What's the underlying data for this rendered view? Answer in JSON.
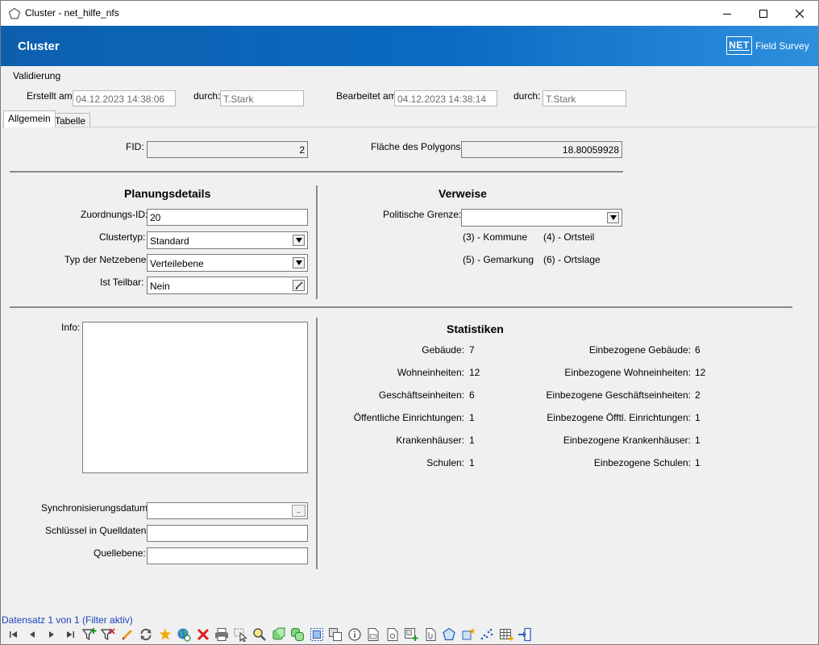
{
  "window": {
    "title": "Cluster - net_hilfe_nfs"
  },
  "banner": {
    "title": "Cluster",
    "logo_text": "NET",
    "product": "Field Survey"
  },
  "validation": {
    "heading": "Validierung",
    "created_label": "Erstellt am:",
    "created_value": "04.12.2023 14:38:06",
    "created_by_label": "durch:",
    "created_by_value": "T.Stark",
    "edited_label": "Bearbeitet am:",
    "edited_value": "04.12.2023 14:38:14",
    "edited_by_label": "durch:",
    "edited_by_value": "T.Stark"
  },
  "tabs": [
    {
      "label": "Allgemein",
      "active": true
    },
    {
      "label": "Tabelle",
      "active": false
    }
  ],
  "general": {
    "fid_label": "FID:",
    "fid_value": "2",
    "area_label": "Fläche des Polygons:",
    "area_value": "18.80059928"
  },
  "planning": {
    "title": "Planungsdetails",
    "assignment_id_label": "Zuordnungs-ID:",
    "assignment_id_value": "20",
    "cluster_type_label": "Clustertyp:",
    "cluster_type_value": "Standard",
    "network_level_label": "Typ der Netzebene:",
    "network_level_value": "Verteilebene",
    "divisible_label": "Ist Teilbar:",
    "divisible_value": "Nein"
  },
  "references": {
    "title": "Verweise",
    "political_border_label": "Politische Grenze:",
    "political_border_value": "",
    "options": [
      "(3) - Kommune",
      "(4) - Ortsteil",
      "(5) - Gemarkung",
      "(6) - Ortslage"
    ]
  },
  "info": {
    "info_label": "Info:",
    "sync_date_label": "Synchronisierungsdatum:",
    "sync_date_button": "..",
    "source_key_label": "Schlüssel in Quelldaten:",
    "source_layer_label": "Quellebene:"
  },
  "statistics": {
    "title": "Statistiken",
    "left": [
      {
        "label": "Gebäude:",
        "value": "7"
      },
      {
        "label": "Wohneinheiten:",
        "value": "12"
      },
      {
        "label": "Geschäftseinheiten:",
        "value": "6"
      },
      {
        "label": "Öffentliche Einrichtungen:",
        "value": "1"
      },
      {
        "label": "Krankenhäuser:",
        "value": "1"
      },
      {
        "label": "Schulen:",
        "value": "1"
      }
    ],
    "right": [
      {
        "label": "Einbezogene Gebäude:",
        "value": "6"
      },
      {
        "label": "Einbezogene Wohneinheiten:",
        "value": "12"
      },
      {
        "label": "Einbezogene Geschäftseinheiten:",
        "value": "2"
      },
      {
        "label": "Einbezogene Öfftl. Einrichtungen:",
        "value": "1"
      },
      {
        "label": "Einbezogene Krankenhäuser:",
        "value": "1"
      },
      {
        "label": "Einbezogene Schulen:",
        "value": "1"
      }
    ]
  },
  "status": {
    "text": "Datensatz 1 von 1 (Filter aktiv)"
  },
  "toolbar": {
    "icons": [
      "first-record-icon",
      "previous-record-icon",
      "next-record-icon",
      "last-record-icon",
      "add-filter-icon",
      "remove-filter-icon",
      "edit-icon",
      "refresh-icon",
      "new-icon",
      "globe-sync-icon",
      "delete-icon",
      "print-icon",
      "select-icon",
      "zoom-icon",
      "shape-icon",
      "merge-icon",
      "copy-area-icon",
      "duplicate-icon",
      "info-icon",
      "report-icon",
      "document-icon",
      "add-document-icon",
      "attachment-icon",
      "polygon-icon",
      "new-polygon-icon",
      "scatter-icon",
      "table-icon",
      "exit-icon"
    ]
  },
  "colors": {
    "banner_start": "#0d5fae",
    "banner_end": "#2f8fde",
    "status_text": "#1a3fbf"
  }
}
